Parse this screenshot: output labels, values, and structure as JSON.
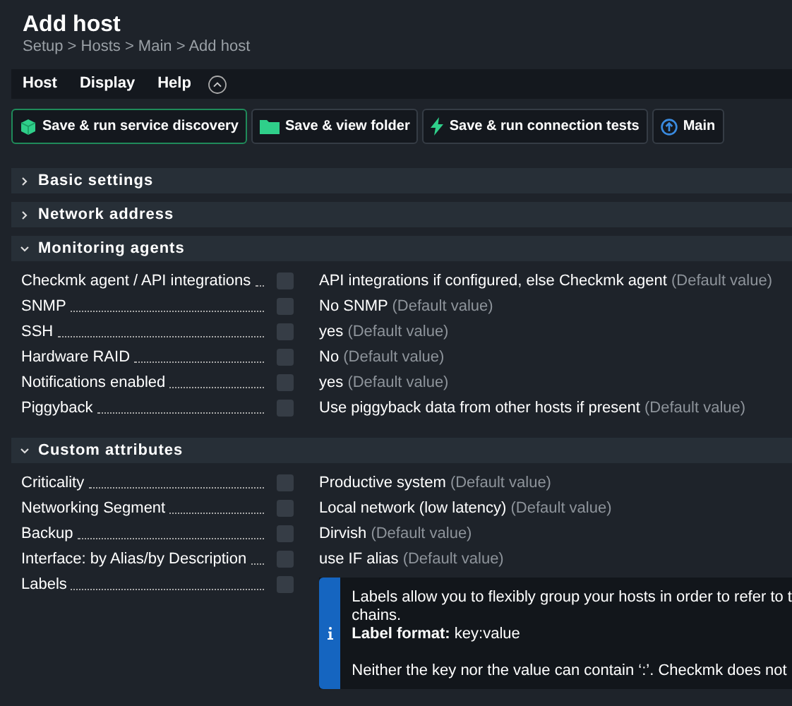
{
  "page": {
    "title": "Add host",
    "breadcrumb": "Setup > Hosts > Main > Add host"
  },
  "menu": [
    "Host",
    "Display",
    "Help"
  ],
  "buttons": [
    {
      "label": "Save & run service discovery",
      "kind": "discovery",
      "selected": true
    },
    {
      "label": "Save & view folder",
      "kind": "folder",
      "selected": false
    },
    {
      "label": "Save & run connection tests",
      "kind": "bolt",
      "selected": false
    },
    {
      "label": "Main",
      "kind": "up",
      "selected": false
    }
  ],
  "sections": [
    {
      "title": "Basic settings",
      "expanded": false
    },
    {
      "title": "Network address",
      "expanded": false
    },
    {
      "title": "Monitoring agents",
      "expanded": true,
      "rows": [
        {
          "label": "Checkmk agent / API integrations",
          "checked": false,
          "value": "API integrations if configured, else Checkmk agent",
          "note": "(Default value)"
        },
        {
          "label": "SNMP",
          "checked": false,
          "value": "No SNMP",
          "note": "(Default value)"
        },
        {
          "label": "SSH",
          "checked": false,
          "value": "yes",
          "note": "(Default value)"
        },
        {
          "label": "Hardware RAID",
          "checked": false,
          "value": "No",
          "note": "(Default value)"
        },
        {
          "label": "Notifications enabled",
          "checked": false,
          "value": "yes",
          "note": "(Default value)"
        },
        {
          "label": "Piggyback",
          "checked": false,
          "value": "Use piggyback data from other hosts if present",
          "note": "(Default value)"
        }
      ]
    },
    {
      "title": "Custom attributes",
      "expanded": true,
      "rows": [
        {
          "label": "Criticality",
          "checked": false,
          "value": "Productive system",
          "note": "(Default value)"
        },
        {
          "label": "Networking Segment",
          "checked": false,
          "value": "Local network (low latency)",
          "note": "(Default value)"
        },
        {
          "label": "Backup",
          "checked": false,
          "value": "Dirvish",
          "note": "(Default value)"
        },
        {
          "label": "Interface: by Alias/by Description",
          "checked": false,
          "value": "use IF alias",
          "note": "(Default value)"
        },
        {
          "label": "Labels",
          "checked": false,
          "info": [
            "Labels allow you to flexibly group your hosts in order to refer to t",
            "chains.",
            "**Label format:** key:value",
            "Neither the key nor the value can contain ‘:’. Checkmk does not"
          ]
        }
      ]
    }
  ]
}
